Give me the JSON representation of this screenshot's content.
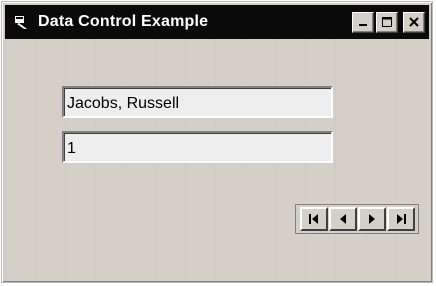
{
  "window": {
    "title": "Data Control Example",
    "icon": "app-window-icon",
    "controls": {
      "minimize_icon": "minimize-icon",
      "maximize_icon": "maximize-icon",
      "close_icon": "close-icon"
    }
  },
  "form": {
    "name_value": "Jacobs, Russell",
    "id_value": "1"
  },
  "data_control": {
    "buttons": [
      "first-record-icon",
      "previous-record-icon",
      "next-record-icon",
      "last-record-icon"
    ]
  },
  "colors": {
    "title_bar": "#0a0a0a",
    "face": "#d4d0c8",
    "textbox_bg": "#eeeeee"
  }
}
